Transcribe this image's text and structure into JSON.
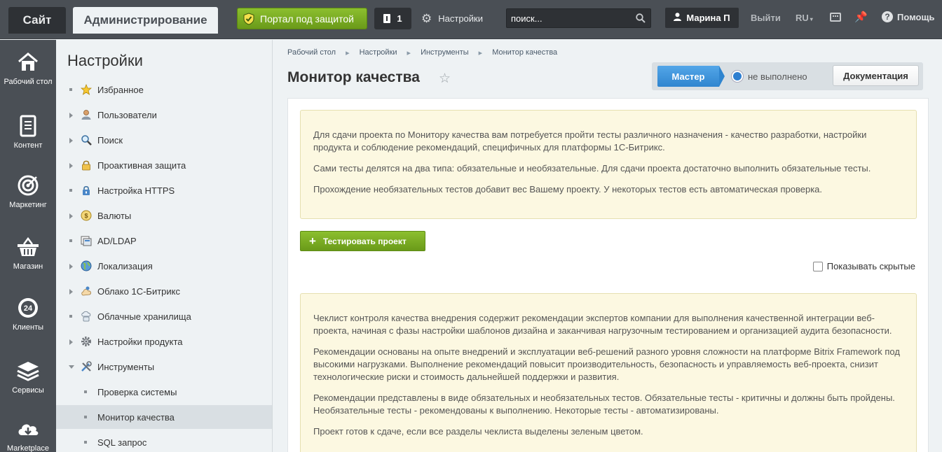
{
  "topbar": {
    "tab_site": "Сайт",
    "tab_admin": "Администрирование",
    "portal_button": "Портал под защитой",
    "notifications_count": "1",
    "settings_link": "Настройки",
    "search_placeholder": "поиск...",
    "user_name": "Марина П",
    "logout": "Выйти",
    "language": "RU",
    "help": "Помощь"
  },
  "leftnav": {
    "items": [
      {
        "label": "Рабочий стол",
        "icon": "home-icon"
      },
      {
        "label": "Контент",
        "icon": "document-icon"
      },
      {
        "label": "Маркетинг",
        "icon": "target-icon"
      },
      {
        "label": "Магазин",
        "icon": "basket-icon"
      },
      {
        "label": "Клиенты",
        "icon": "clock-24-icon"
      },
      {
        "label": "Сервисы",
        "icon": "layers-icon"
      },
      {
        "label": "Marketplace",
        "icon": "cloud-download-icon"
      }
    ]
  },
  "sidebar": {
    "title": "Настройки",
    "items": [
      {
        "label": "Избранное",
        "marker": "dot",
        "icon": "star-icon"
      },
      {
        "label": "Пользователи",
        "marker": "arrow",
        "icon": "user-icon"
      },
      {
        "label": "Поиск",
        "marker": "arrow",
        "icon": "magnifier-icon"
      },
      {
        "label": "Проактивная защита",
        "marker": "arrow",
        "icon": "lock-icon"
      },
      {
        "label": "Настройка HTTPS",
        "marker": "dot",
        "icon": "https-lock-icon"
      },
      {
        "label": "Валюты",
        "marker": "arrow",
        "icon": "currency-icon"
      },
      {
        "label": "AD/LDAP",
        "marker": "dot",
        "icon": "ldap-icon"
      },
      {
        "label": "Локализация",
        "marker": "arrow",
        "icon": "globe-icon"
      },
      {
        "label": "Облако 1С-Битрикс",
        "marker": "arrow",
        "icon": "cloud-hand-icon"
      },
      {
        "label": "Облачные хранилища",
        "marker": "dot",
        "icon": "cloud-storage-icon"
      },
      {
        "label": "Настройки продукта",
        "marker": "arrow",
        "icon": "gear-icon"
      },
      {
        "label": "Инструменты",
        "marker": "expanded",
        "icon": "tools-icon"
      }
    ],
    "subitems": [
      {
        "label": "Проверка системы"
      },
      {
        "label": "Монитор качества"
      },
      {
        "label": "SQL запрос"
      }
    ]
  },
  "breadcrumb": [
    "Рабочий стол",
    "Настройки",
    "Инструменты",
    "Монитор качества"
  ],
  "page": {
    "title": "Монитор качества",
    "master_button": "Мастер",
    "status_text": "не выполнено",
    "docs_button": "Документация",
    "test_button": "Тестировать проект",
    "show_hidden": "Показывать скрытые"
  },
  "notice1": {
    "p1": "Для сдачи проекта по Монитору качества вам потребуется пройти тесты различного назначения - качество разработки, настройки продукта и соблюдение рекомендаций, специфичных для платформы 1С-Битрикс.",
    "p2": "Сами тесты делятся на два типа: обязательные и необязательные. Для сдачи проекта достаточно выполнить обязательные тесты.",
    "p3": "Прохождение необязательных тестов добавит вес Вашему проекту. У некоторых тестов есть автоматическая проверка."
  },
  "notice2": {
    "p1": "Чеклист контроля качества внедрения содержит рекомендации экспертов компании для выполнения качественной интеграции веб-проекта, начиная с фазы настройки шаблонов дизайна и заканчивая нагрузочным тестированием и организацией аудита безопасности.",
    "p2": "Рекомендации основаны на опыте внедрений и эксплуатации веб-решений разного уровня сложности на платформе Bitrix Framework под высокими нагрузками. Выполнение рекомендаций повысит производительность, безопасность и управляемость веб-проекта, снизит технологические риски и стоимость дальнейшей поддержки и развития.",
    "p3": "Рекомендации представлены в виде обязательных и необязательных тестов. Обязательные тесты - критичны и должны быть пройдены. Необязательные тесты - рекомендованы к выполнению. Некоторые тесты - автоматизированы.",
    "p4": "Проект готов к сдаче, если все разделы чеклиста выделены зеленым цветом."
  },
  "colors": {
    "topbar": "#4a4f55",
    "accent_green": "#7aab22",
    "accent_blue": "#3a8fd8",
    "notice_bg": "#fcf8e1"
  }
}
